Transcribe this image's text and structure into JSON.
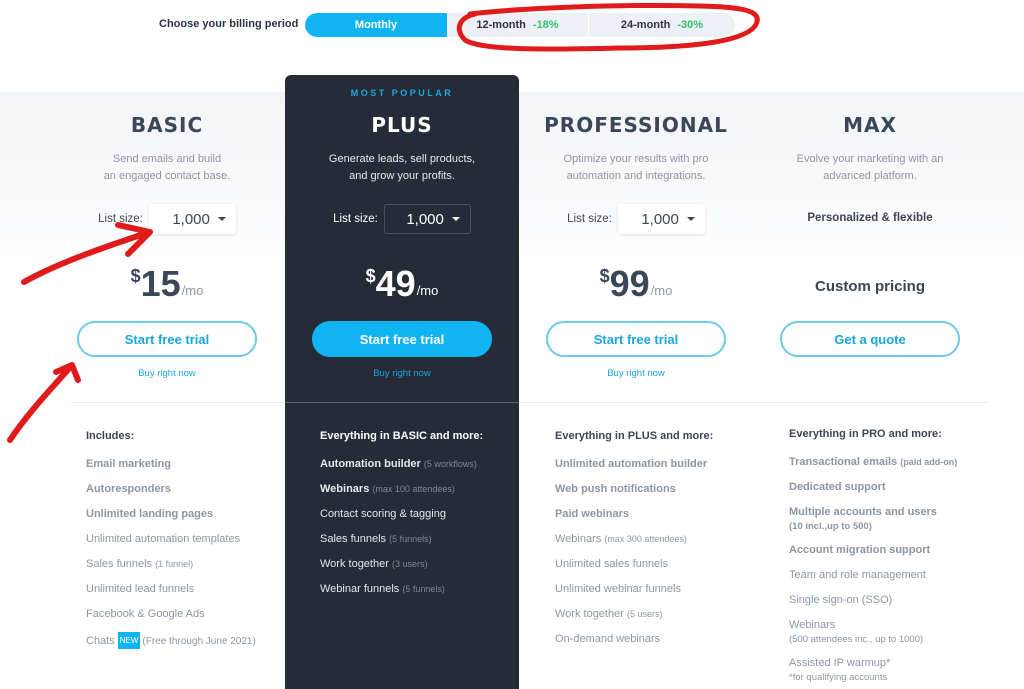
{
  "billing": {
    "label": "Choose your billing period",
    "periods": [
      {
        "label": "Monthly",
        "discount": "",
        "active": true
      },
      {
        "label": "12-month",
        "discount": "-18%",
        "active": false
      },
      {
        "label": "24-month",
        "discount": "-30%",
        "active": false
      }
    ]
  },
  "badge_most_popular": "MOST POPULAR",
  "colors": {
    "accent": "#11b4f2",
    "dark_card": "#252c37",
    "discount_green": "#2ec26a",
    "annotation_red": "#e01b1b"
  },
  "plans": [
    {
      "name": "BASIC",
      "desc_line1": "Send emails and build",
      "desc_line2": "an engaged contact base.",
      "list_size_label": "List size:",
      "list_size_value": "1,000",
      "currency": "$",
      "price": "15",
      "period": "/mo",
      "cta": "Start free trial",
      "buy_now": "Buy right now",
      "features_heading": "Includes:",
      "features": [
        {
          "text": "Email marketing",
          "note": ""
        },
        {
          "text": "Autoresponders",
          "note": ""
        },
        {
          "text": "Unlimited landing pages",
          "note": ""
        },
        {
          "text": "Unlimited automation templates",
          "note": ""
        },
        {
          "text": "Sales funnels",
          "note": "(1 funnel)"
        },
        {
          "text": "Unlimited lead funnels",
          "note": ""
        },
        {
          "text": "Facebook & Google Ads",
          "note": ""
        },
        {
          "text": "Chats",
          "badge": "NEW",
          "note": "(Free through June 2021)"
        }
      ]
    },
    {
      "name": "PLUS",
      "desc_line1": "Generate leads, sell products,",
      "desc_line2": "and grow your profits.",
      "list_size_label": "List size:",
      "list_size_value": "1,000",
      "currency": "$",
      "price": "49",
      "period": "/mo",
      "cta": "Start free trial",
      "buy_now": "Buy right now",
      "features_heading": "Everything in BASIC and more:",
      "features": [
        {
          "text": "Automation builder",
          "note": "(5 workflows)"
        },
        {
          "text": "Webinars",
          "note": "(max 100 attendees)"
        },
        {
          "text": "Contact scoring & tagging",
          "note": ""
        },
        {
          "text": "Sales funnels",
          "note": "(5 funnels)"
        },
        {
          "text": "Work together",
          "note": "(3 users)"
        },
        {
          "text": "Webinar funnels",
          "note": "(5 funnels)"
        }
      ]
    },
    {
      "name": "PROFESSIONAL",
      "desc_line1": "Optimize your results with pro",
      "desc_line2": "automation and integrations.",
      "list_size_label": "List size:",
      "list_size_value": "1,000",
      "currency": "$",
      "price": "99",
      "period": "/mo",
      "cta": "Start free trial",
      "buy_now": "Buy right now",
      "features_heading": "Everything in PLUS and more:",
      "features": [
        {
          "text": "Unlimited automation builder",
          "note": ""
        },
        {
          "text": "Web push notifications",
          "note": ""
        },
        {
          "text": "Paid webinars",
          "note": ""
        },
        {
          "text": "Webinars",
          "note": "(max 300 attendees)"
        },
        {
          "text": "Unlimited sales funnels",
          "note": ""
        },
        {
          "text": "Unlimited webinar funnels",
          "note": ""
        },
        {
          "text": "Work together",
          "note": "(5 users)"
        },
        {
          "text": "On-demand webinars",
          "note": ""
        }
      ]
    },
    {
      "name": "MAX",
      "desc_line1": "Evolve your marketing with an",
      "desc_line2": "advanced platform.",
      "flex_label": "Personalized & flexible",
      "custom_price": "Custom pricing",
      "cta": "Get a quote",
      "features_heading": "Everything in PRO and more:",
      "features": [
        {
          "text": "Transactional emails",
          "note": "(paid add-on)"
        },
        {
          "text": "Dedicated support",
          "note": ""
        },
        {
          "text": "Multiple accounts and users",
          "sub": "(10 incl.,up to 500)"
        },
        {
          "text": "Account migration support",
          "note": ""
        },
        {
          "text": "Team and role management",
          "note": ""
        },
        {
          "text": "Single sign-on (SSO)",
          "note": ""
        },
        {
          "text": "Webinars",
          "sub": "(500 attendees inc., up to 1000)"
        },
        {
          "text": "Assisted IP warmup*",
          "sub": "*for qualifying accounts"
        }
      ]
    }
  ]
}
